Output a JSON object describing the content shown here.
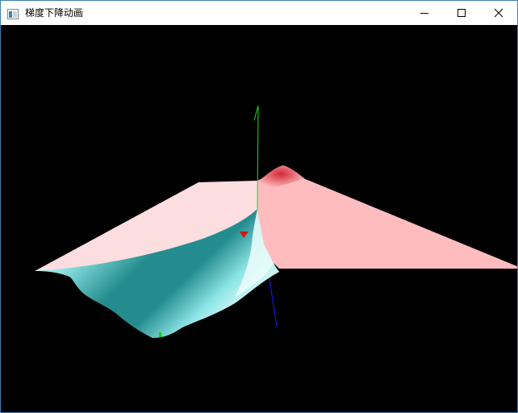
{
  "window": {
    "title": "梯度下降动画",
    "icon": "app-window-icon",
    "controls": {
      "minimize_icon": "minimize-icon",
      "maximize_icon": "maximize-icon",
      "close_icon": "close-icon"
    }
  },
  "scene": {
    "background": "#000000",
    "surface_colors": {
      "plateau": "#fcdde0",
      "high": "#ffbcbf",
      "peak": "#d02a38",
      "valley_light": "#e8fcfb",
      "valley_mid": "#8fe6e6",
      "valley_deep": "#248c8e"
    },
    "axes_colors": {
      "y_axis": "#19e019",
      "z_axis": "#1a1aff"
    },
    "markers": {
      "current_point_color": "#e01010",
      "minimum_point_color": "#10d010"
    }
  }
}
